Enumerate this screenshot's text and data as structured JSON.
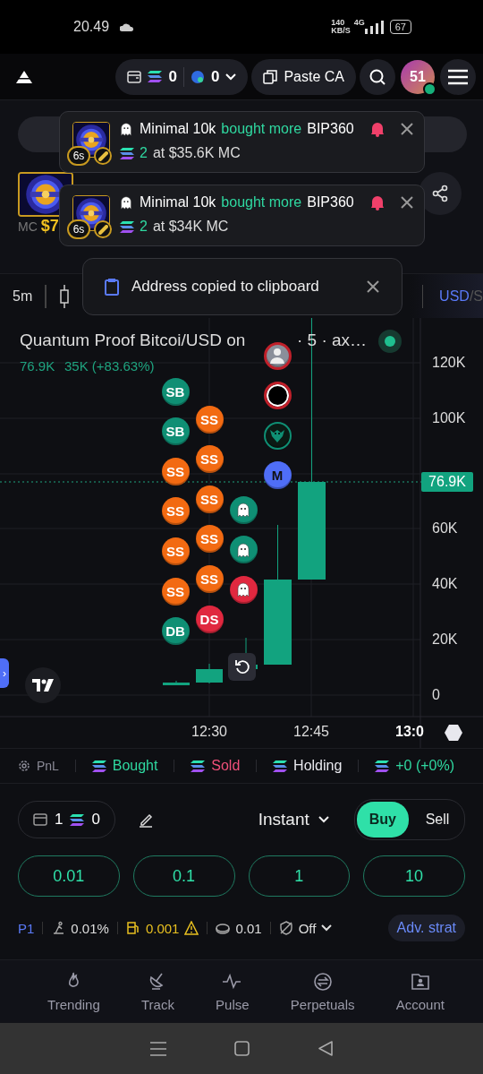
{
  "status_bar": {
    "time": "20.49",
    "speed": "140",
    "speed_unit": "KB/S",
    "network": "4G",
    "battery": "67"
  },
  "header": {
    "wallet_sol": "0",
    "wallet_points": "0",
    "paste_button": "Paste CA",
    "avatar": {
      "label": "51",
      "online": true
    }
  },
  "token": {
    "mc_label": "MC",
    "mc_value": "$7"
  },
  "toasts": [
    {
      "trader": "Minimal 10k",
      "action": "bought more",
      "token": "BIP360",
      "age": "6s",
      "amount": "2",
      "detail": "at $35.6K MC"
    },
    {
      "trader": "Minimal 10k",
      "action": "bought more",
      "token": "BIP360",
      "age": "6s",
      "amount": "2",
      "detail": "at $34K MC"
    }
  ],
  "clipboard_toast": {
    "message": "Address copied to clipboard"
  },
  "chart_toolbar": {
    "interval": "5m",
    "currency": "USD",
    "currency_alt": "/S"
  },
  "chart": {
    "title": "Quantum Proof Bitcoi/USD on",
    "title_tail": "· 5 · ax…",
    "last": "76.9K",
    "change": "35K (+83.63%)",
    "price_tag": "76.9K",
    "side_tab": "›",
    "y_labels": [
      "120K",
      "100K",
      "60K",
      "40K",
      "20K",
      "0"
    ],
    "x_labels": [
      {
        "label": "12:30",
        "bold": false
      },
      {
        "label": "12:45",
        "bold": false
      },
      {
        "label": "13:0",
        "bold": true
      }
    ],
    "marker_columns": [
      {
        "markers": [
          {
            "kind": "letters",
            "label": "SB",
            "color": "#0f8f74"
          },
          {
            "kind": "letters",
            "label": "SB",
            "color": "#0f8f74"
          },
          {
            "kind": "letters",
            "label": "SS",
            "color": "#f26a12"
          },
          {
            "kind": "letters",
            "label": "SS",
            "color": "#f26a12"
          },
          {
            "kind": "letters",
            "label": "SS",
            "color": "#f26a12"
          },
          {
            "kind": "letters",
            "label": "SS",
            "color": "#f26a12"
          },
          {
            "kind": "letters",
            "label": "DB",
            "color": "#0f8f74"
          }
        ]
      },
      {
        "markers": [
          {
            "kind": "letters",
            "label": "SS",
            "color": "#f26a12"
          },
          {
            "kind": "letters",
            "label": "SS",
            "color": "#f26a12"
          },
          {
            "kind": "letters",
            "label": "SS",
            "color": "#f26a12"
          },
          {
            "kind": "letters",
            "label": "SS",
            "color": "#f26a12"
          },
          {
            "kind": "letters",
            "label": "SS",
            "color": "#f26a12"
          },
          {
            "kind": "letters",
            "label": "DS",
            "color": "#e0283f"
          }
        ]
      },
      {
        "markers": [
          {
            "kind": "ghost",
            "color": "#0f8f74"
          },
          {
            "kind": "ghost",
            "color": "#0f8f74"
          },
          {
            "kind": "ghost",
            "color": "#e0283f"
          }
        ]
      },
      {
        "markers": [
          {
            "kind": "avatar",
            "color": "#c0202a"
          },
          {
            "kind": "ring",
            "color": "#c0202a"
          },
          {
            "kind": "bird",
            "color": "#0f8f74"
          },
          {
            "kind": "logo",
            "label": "M",
            "color": "#4f6ef7"
          }
        ]
      }
    ]
  },
  "pnl": [
    {
      "kind": "settings",
      "label": "PnL",
      "color": "#8a8a96"
    },
    {
      "kind": "sol",
      "label": "Bought",
      "color": "#2fd8a0"
    },
    {
      "kind": "sol",
      "label": "Sold",
      "color": "#f0507a"
    },
    {
      "kind": "sol",
      "label": "Holding",
      "color": "#e8e8ee"
    },
    {
      "kind": "sol",
      "label": "+0 (+0%)",
      "color": "#2fd8a0"
    }
  ],
  "trade": {
    "wallets": "1",
    "balance": "0",
    "mode": "Instant",
    "sides": [
      {
        "label": "Buy",
        "selected": true
      },
      {
        "label": "Sell",
        "selected": false
      }
    ],
    "amounts": [
      "0.01",
      "0.1",
      "1",
      "10"
    ],
    "preset": "P1",
    "slippage": "0.01%",
    "fee": "0.001",
    "tip": "0.01",
    "mev": "Off",
    "adv_button": "Adv. strat"
  },
  "nav": [
    {
      "kind": "flame",
      "label": "Trending"
    },
    {
      "kind": "dish",
      "label": "Track"
    },
    {
      "kind": "pulse",
      "label": "Pulse"
    },
    {
      "kind": "swap",
      "label": "Perpetuals"
    },
    {
      "kind": "account",
      "label": "Account"
    }
  ]
}
